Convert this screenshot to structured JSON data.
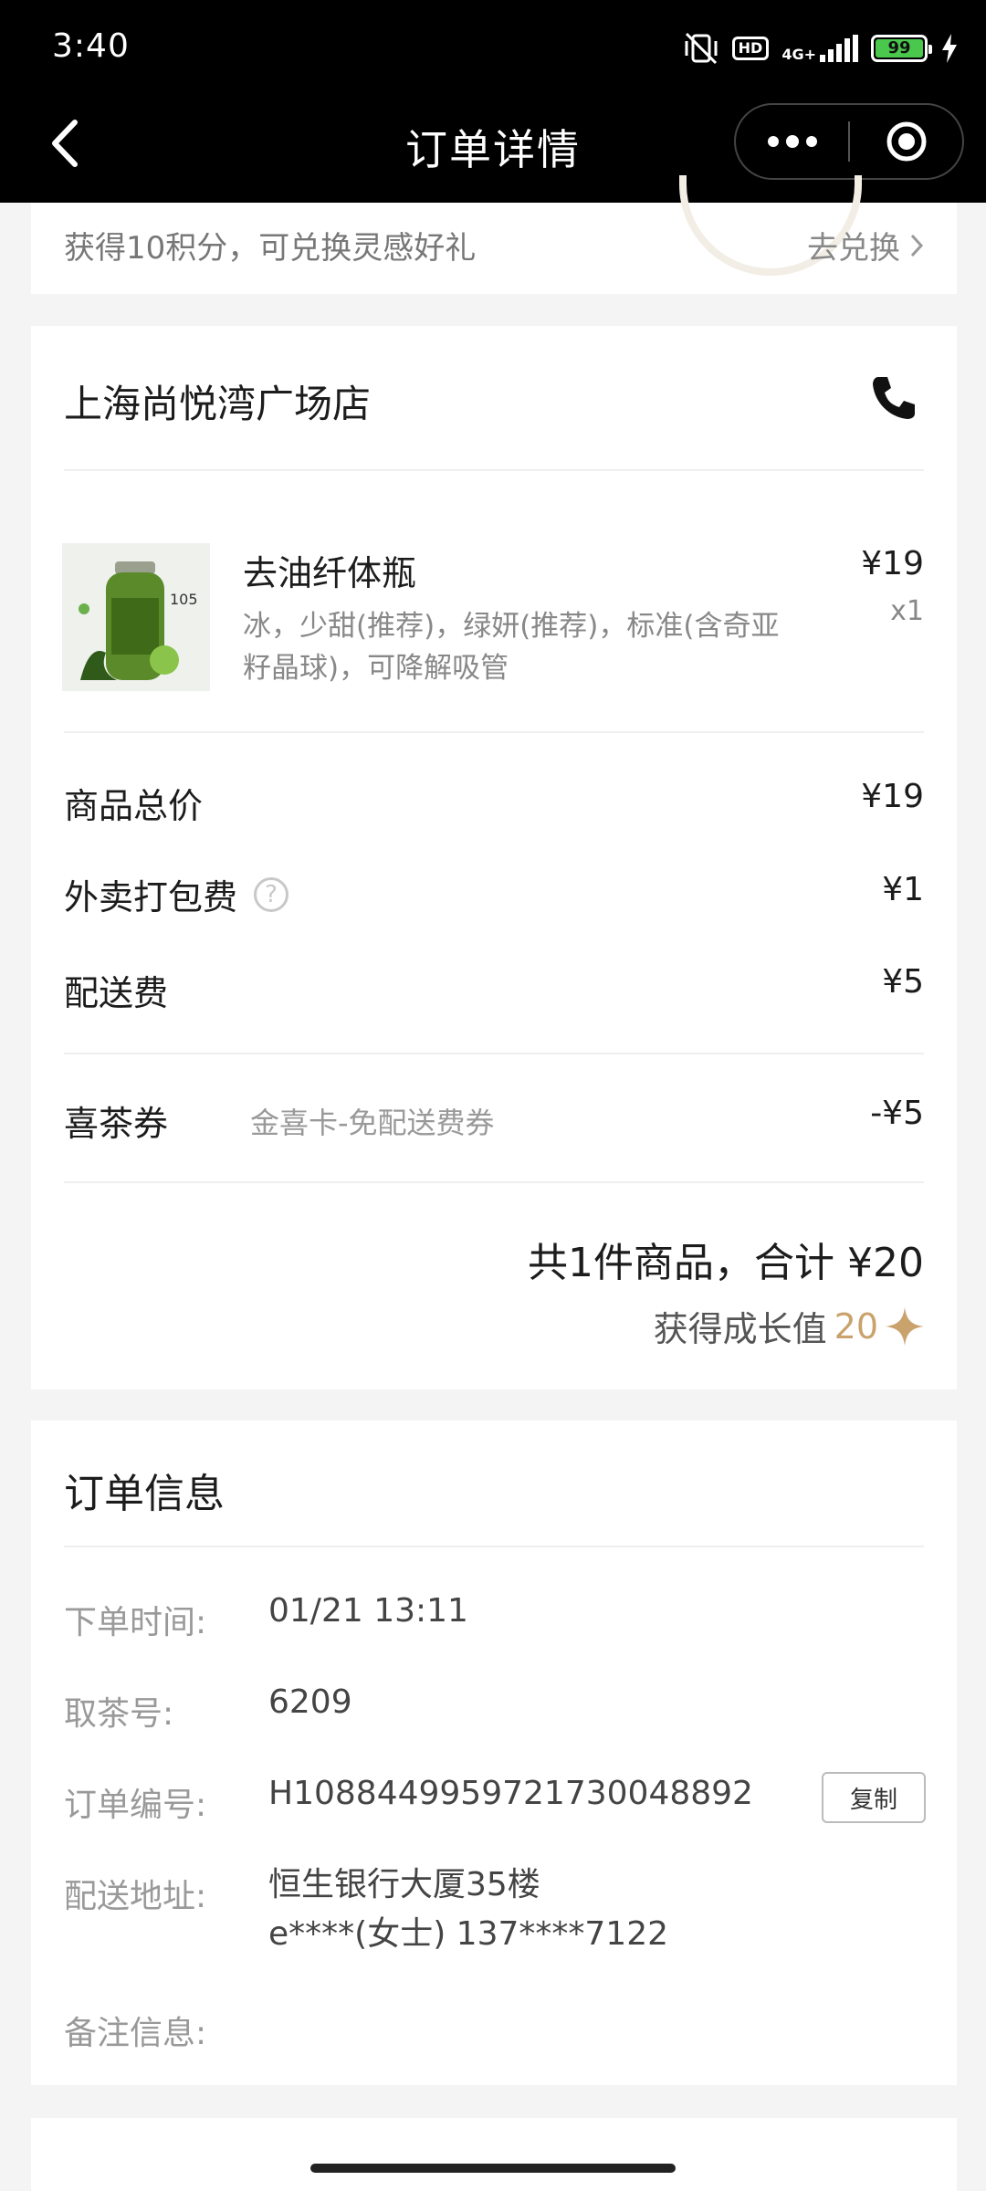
{
  "status_bar": {
    "time": "3:40",
    "network": "4G+",
    "hd": "HD",
    "battery": "99"
  },
  "header": {
    "title": "订单详情",
    "back_icon": "back-arrow-icon",
    "more_icon": "more-dots-icon",
    "close_icon": "target-icon"
  },
  "points": {
    "text": "获得10积分，可兑换灵感好礼",
    "link": "去兑换"
  },
  "order": {
    "store": "上海尚悦湾广场店",
    "product": {
      "name": "去油纤体瓶",
      "spec": "冰，少甜(推荐)，绿妍(推荐)，标准(含奇亚籽晶球)，可降解吸管",
      "price": "¥19",
      "qty": "x1",
      "image_label": "105"
    },
    "rows": [
      {
        "label": "商品总价",
        "value": "¥19"
      },
      {
        "label": "外卖打包费",
        "value": "¥1"
      },
      {
        "label": "配送费",
        "value": "¥5"
      }
    ],
    "coupon": {
      "label": "喜茶券",
      "desc": "金喜卡-免配送费券",
      "value": "-¥5"
    },
    "total": "共1件商品，合计 ¥20",
    "growth_label": "获得成长值",
    "growth_value": "20"
  },
  "info": {
    "title": "订单信息",
    "rows": [
      {
        "label": "下单时间:",
        "value": "01/21 13:11"
      },
      {
        "label": "取茶号:",
        "value": "6209"
      },
      {
        "label": "订单编号:",
        "value": "H10884499597217300488​92"
      },
      {
        "label": "配送地址:",
        "value": "恒生银行大厦35楼",
        "value2": "e****(女士) 137****7122"
      },
      {
        "label": "备注信息:",
        "value": ""
      }
    ],
    "copy_label": "复制"
  },
  "colors": {
    "accent_gold": "#c9a26c",
    "battery_green": "#49c84d"
  }
}
